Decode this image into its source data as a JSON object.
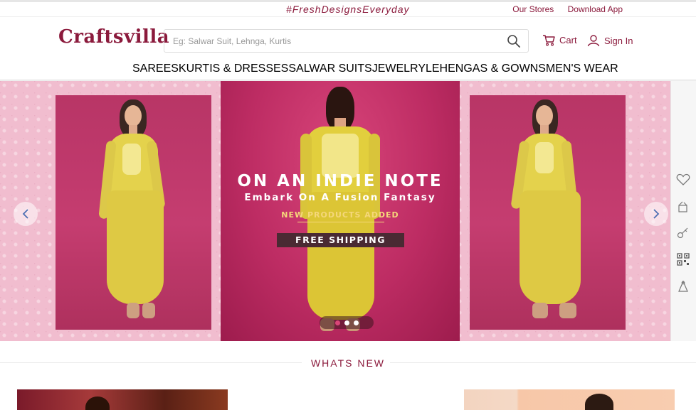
{
  "topbar": {
    "tagline": "#FreshDesignsEveryday",
    "links": [
      "Our Stores",
      "Download App"
    ]
  },
  "header": {
    "logo": "Craftsvilla",
    "search_placeholder": "Eg: Salwar Suit, Lehnga, Kurtis",
    "cart_label": "Cart",
    "signin_label": "Sign In"
  },
  "nav": {
    "items": [
      "SAREES",
      "KURTIS & DRESSES",
      "SALWAR SUITS",
      "JEWELRY",
      "LEHENGAS & GOWNS",
      "MEN'S WEAR"
    ]
  },
  "hero": {
    "title": "ON AN INDIE NOTE",
    "subtitle": "Embark On A Fusion Fantasy",
    "tagline": "NEW PRODUCTS ADDED",
    "badge": "FREE SHIPPING",
    "slide_count": 3,
    "active_slide": 1
  },
  "rail_icons": [
    "heart-icon",
    "gift-icon",
    "key-icon",
    "qr-code-icon",
    "user-icon"
  ],
  "section": {
    "title": "WHATS NEW"
  },
  "colors": {
    "brand": "#8b1a3c",
    "hero_pink": "#bd2c63",
    "pattern_pink": "#f0b8cb",
    "garment_yellow": "#e2cf3d"
  }
}
